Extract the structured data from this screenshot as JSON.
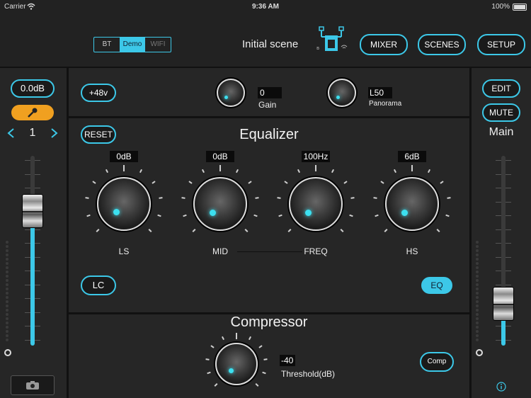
{
  "status_bar": {
    "carrier": "Carrier",
    "time": "9:36 AM",
    "battery": "100%"
  },
  "header": {
    "connection_tabs": [
      "BT",
      "Demo",
      "WIFI"
    ],
    "scene_title": "Initial scene",
    "buttons": {
      "mixer": "MIXER",
      "scenes": "SCENES",
      "setup": "SETUP"
    }
  },
  "channel_strip": {
    "level": "0.0dB",
    "channel_number": "1",
    "fader_level": 0.71
  },
  "main_strip": {
    "edit": "EDIT",
    "mute": "MUTE",
    "title": "Main",
    "fader_level": 0.22
  },
  "gain_section": {
    "phantom": "+48v",
    "gain_value": "0",
    "gain_label": "Gain",
    "panorama_value": "L50",
    "panorama_label": "Panorama"
  },
  "equalizer": {
    "title": "Equalizer",
    "reset": "RESET",
    "bands": [
      {
        "value": "0dB",
        "label": "LS"
      },
      {
        "value": "0dB",
        "label": "MID"
      },
      {
        "value": "100Hz",
        "label": "FREQ"
      },
      {
        "value": "6dB",
        "label": "HS"
      }
    ],
    "lc": "LC",
    "eq": "EQ"
  },
  "compressor": {
    "title": "Compressor",
    "threshold_value": "-40",
    "threshold_label": "Threshold(dB)",
    "comp": "Comp"
  },
  "colors": {
    "accent": "#3cc8e8",
    "orange": "#f0a020",
    "background": "#262626"
  }
}
